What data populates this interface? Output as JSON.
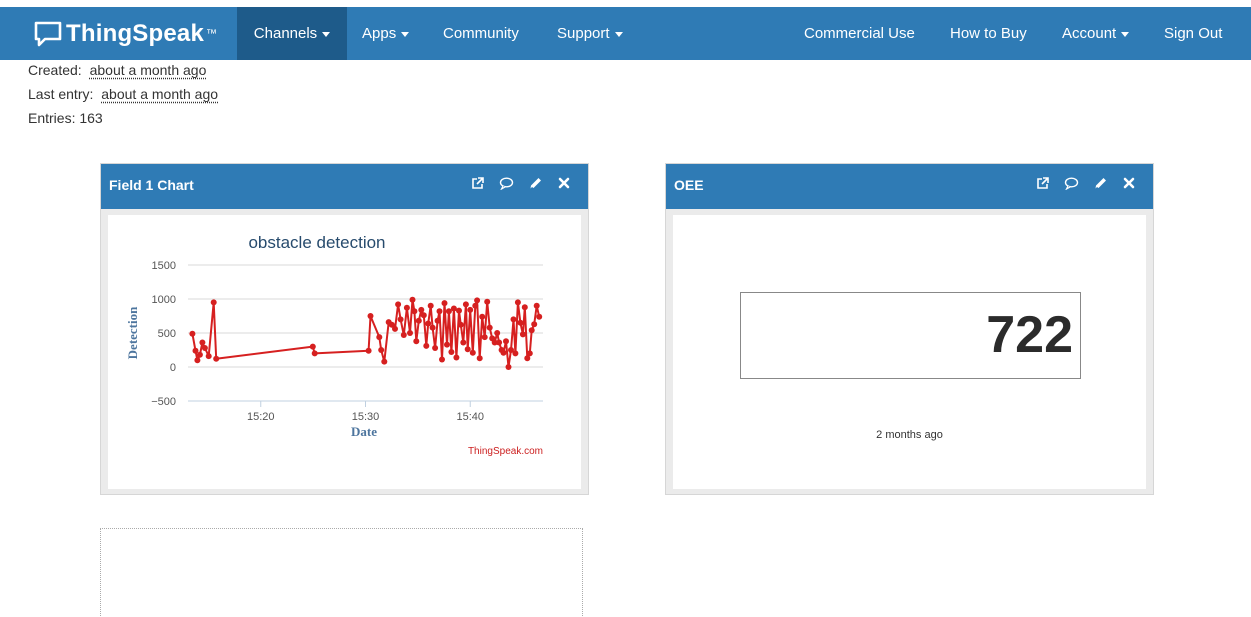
{
  "nav": {
    "brand": "ThingSpeak",
    "brand_tm": "™",
    "items": [
      {
        "label": "Channels",
        "dropdown": true,
        "active": true
      },
      {
        "label": "Apps",
        "dropdown": true
      },
      {
        "label": "Community",
        "dropdown": false
      },
      {
        "label": "Support",
        "dropdown": true
      }
    ],
    "right_items": [
      {
        "label": "Commercial Use",
        "dropdown": false
      },
      {
        "label": "How to Buy",
        "dropdown": false
      },
      {
        "label": "Account",
        "dropdown": true
      },
      {
        "label": "Sign Out",
        "dropdown": false
      }
    ]
  },
  "channel_info": {
    "created_label": "Created:",
    "created_value": "about a month ago",
    "last_entry_label": "Last entry:",
    "last_entry_value": "about a month ago",
    "entries_label": "Entries:",
    "entries_value": "163"
  },
  "widgets": [
    {
      "title": "Field 1 Chart",
      "tools": [
        "external-link-icon",
        "comment-icon",
        "pencil-icon",
        "close-icon"
      ]
    },
    {
      "title": "OEE",
      "value": "722",
      "timestamp": "2 months ago",
      "tools": [
        "external-link-icon",
        "comment-icon",
        "pencil-icon",
        "close-icon"
      ]
    }
  ],
  "chart_data": {
    "type": "line",
    "title": "obstacle detection",
    "xlabel": "Date",
    "ylabel": "Detection",
    "credit": "ThingSpeak.com",
    "ylim": [
      -500,
      1500
    ],
    "yticks": [
      -500,
      0,
      500,
      1000,
      1500
    ],
    "xlim": [
      15.217,
      15.783
    ],
    "xticks": [
      {
        "value": 15.333,
        "label": "15:20"
      },
      {
        "value": 15.5,
        "label": "15:30"
      },
      {
        "value": 15.667,
        "label": "15:40"
      }
    ],
    "grid": true,
    "line_color": "#d62020",
    "series": [
      {
        "x": [
          15.224,
          15.229,
          15.232,
          15.236,
          15.24,
          15.244,
          15.25,
          15.258,
          15.262,
          15.416,
          15.419,
          15.505,
          15.508,
          15.522,
          15.525,
          15.53,
          15.537,
          15.542,
          15.547,
          15.552,
          15.556,
          15.561,
          15.566,
          15.571,
          15.575,
          15.578,
          15.581,
          15.585,
          15.589,
          15.593,
          15.597,
          15.6,
          15.604,
          15.607,
          15.611,
          15.615,
          15.618,
          15.622,
          15.626,
          15.63,
          15.633,
          15.637,
          15.641,
          15.645,
          15.649,
          15.652,
          15.656,
          15.66,
          15.663,
          15.667,
          15.671,
          15.675,
          15.678,
          15.682,
          15.686,
          15.69,
          15.694,
          15.698,
          15.702,
          15.706,
          15.71,
          15.713,
          15.717,
          15.72,
          15.724,
          15.728,
          15.732,
          15.736,
          15.739,
          15.743,
          15.747,
          15.751,
          15.754,
          15.758,
          15.762,
          15.765,
          15.769,
          15.773,
          15.777
        ],
        "y": [
          490,
          240,
          100,
          180,
          360,
          280,
          160,
          950,
          120,
          300,
          200,
          240,
          750,
          440,
          250,
          80,
          660,
          620,
          560,
          920,
          700,
          470,
          870,
          500,
          990,
          820,
          380,
          680,
          840,
          760,
          310,
          640,
          900,
          580,
          280,
          680,
          820,
          110,
          940,
          330,
          820,
          220,
          860,
          140,
          830,
          620,
          360,
          920,
          260,
          840,
          210,
          900,
          980,
          130,
          740,
          440,
          960,
          580,
          420,
          360,
          500,
          360,
          250,
          210,
          380,
          0,
          250,
          700,
          200,
          950,
          650,
          480,
          880,
          130,
          200,
          540,
          630,
          900,
          740
        ]
      }
    ]
  }
}
